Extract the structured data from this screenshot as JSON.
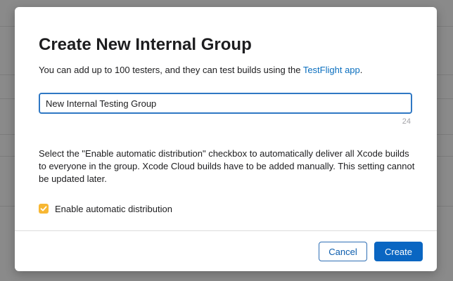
{
  "dialog": {
    "title": "Create New Internal Group",
    "subtitle_prefix": "You can add up to 100 testers, and they can test builds using the ",
    "subtitle_link": "TestFlight app",
    "subtitle_suffix": ".",
    "group_name_value": "New Internal Testing Group",
    "char_count": "24",
    "description": "Select the \"Enable automatic distribution\" checkbox to automatically deliver all Xcode builds to everyone in the group. Xcode Cloud builds have to be added manually. This setting cannot be updated later.",
    "checkbox": {
      "label": "Enable automatic distribution",
      "checked": true
    },
    "buttons": {
      "cancel": "Cancel",
      "create": "Create"
    }
  },
  "colors": {
    "accent": "#0a66c2",
    "link": "#0b6fbf",
    "checkbox": "#f7b733",
    "backdrop": "#8a8a8a"
  }
}
